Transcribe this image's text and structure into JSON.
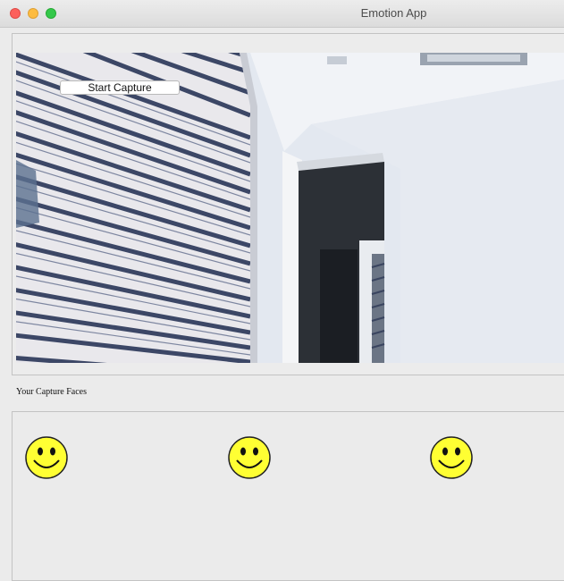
{
  "window": {
    "title": "Emotion App"
  },
  "camera": {
    "start_button_label": "Start Capture"
  },
  "captured": {
    "label": "Your Capture Faces",
    "faces": [
      {
        "icon": "smiley-face-icon"
      },
      {
        "icon": "smiley-face-icon"
      },
      {
        "icon": "smiley-face-icon"
      }
    ]
  }
}
